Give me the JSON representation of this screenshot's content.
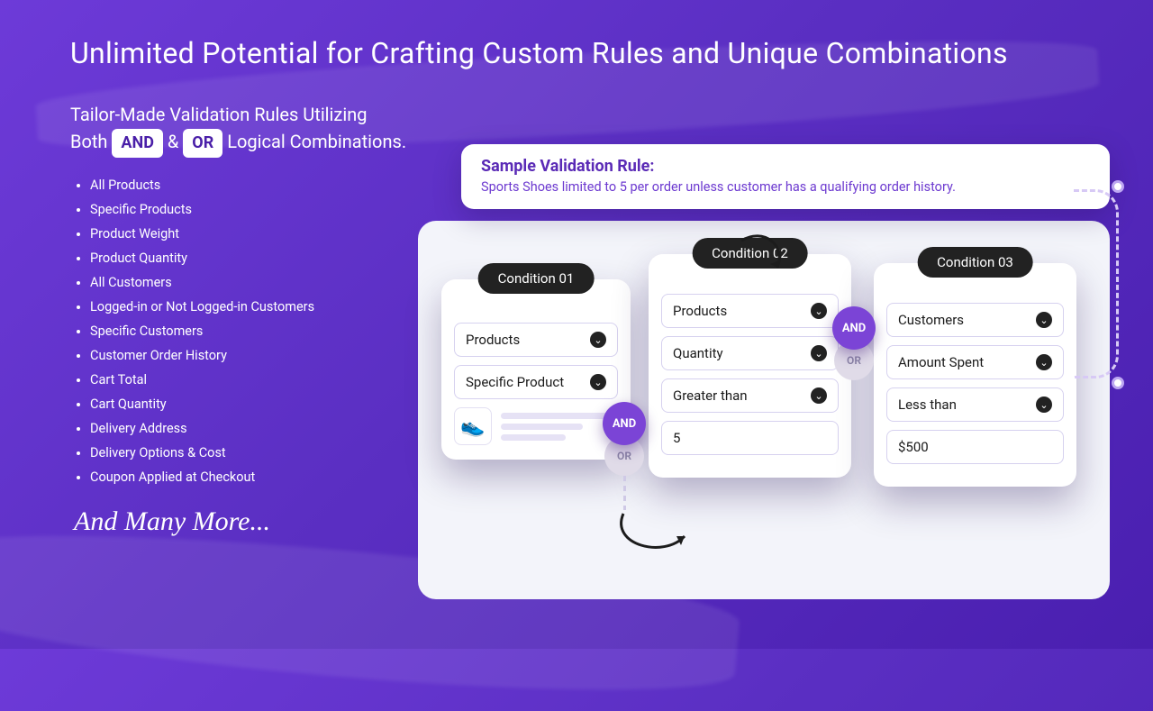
{
  "title": "Unlimited Potential for Crafting Custom Rules and Unique Combinations",
  "subtitle": {
    "line1": "Tailor-Made Validation Rules Utilizing",
    "line2_a": "Both",
    "and_pill": "AND",
    "amp": "&",
    "or_pill": "OR",
    "line2_b": "Logical Combinations."
  },
  "bullets": [
    "All Products",
    "Specific Products",
    "Product Weight",
    "Product Quantity",
    "All Customers",
    "Logged-in or Not Logged-in Customers",
    "Specific Customers",
    "Customer Order History",
    "Cart Total",
    "Cart Quantity",
    "Delivery Address",
    "Delivery Options & Cost",
    "Coupon Applied at Checkout"
  ],
  "scriptnote": "And Many More...",
  "sample": {
    "heading": "Sample Validation Rule:",
    "desc": "Sports Shoes limited to 5 per order unless customer has a qualifying order history."
  },
  "joiner": {
    "and": "AND",
    "or": "OR"
  },
  "cond1": {
    "tab": "Condition 01",
    "f1": "Products",
    "f2": "Specific Product",
    "shoe": "👟"
  },
  "cond2": {
    "tab": "Condition 02",
    "f1": "Products",
    "f2": "Quantity",
    "f3": "Greater than",
    "f4": "5"
  },
  "cond3": {
    "tab": "Condition 03",
    "f1": "Customers",
    "f2": "Amount Spent",
    "f3": "Less than",
    "f4": "$500"
  }
}
